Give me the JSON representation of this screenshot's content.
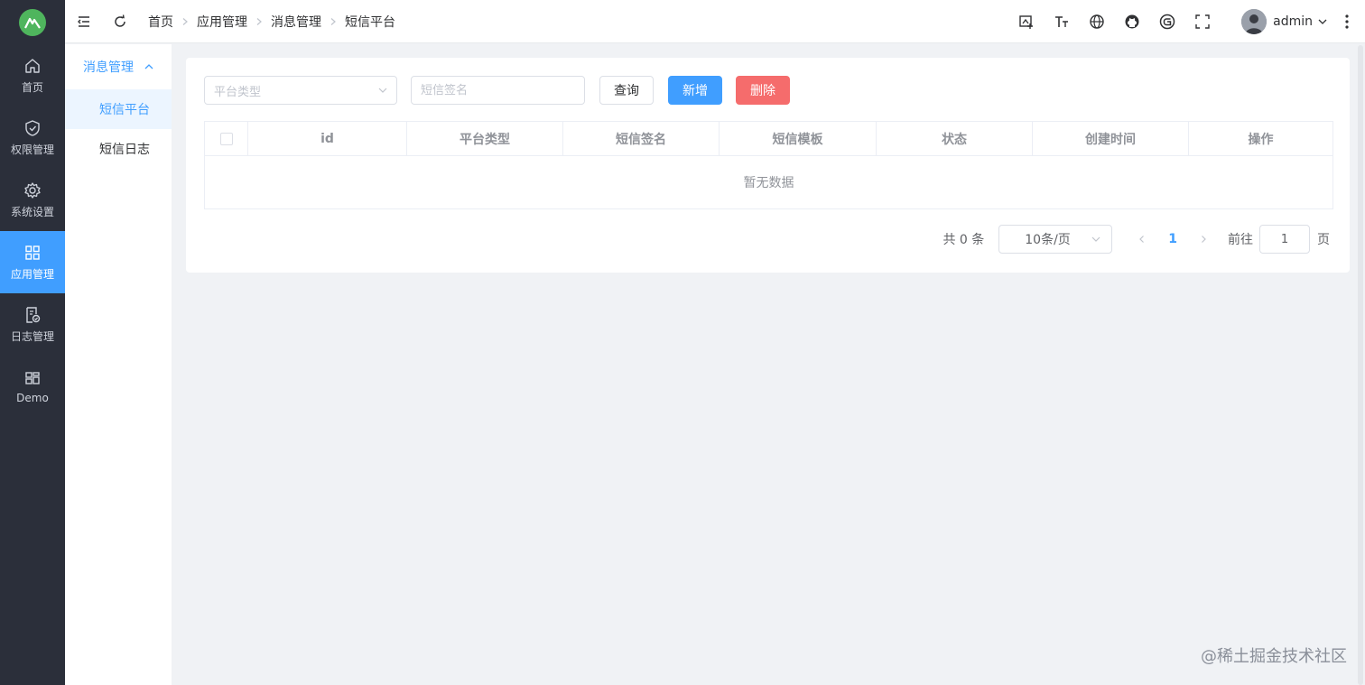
{
  "rail": {
    "items": [
      {
        "label": "首页",
        "icon": "home-icon"
      },
      {
        "label": "权限管理",
        "icon": "shield-icon"
      },
      {
        "label": "系统设置",
        "icon": "gear-icon"
      },
      {
        "label": "应用管理",
        "icon": "grid-icon",
        "active": true
      },
      {
        "label": "日志管理",
        "icon": "log-icon"
      },
      {
        "label": "Demo",
        "icon": "layout-icon"
      }
    ]
  },
  "submenu": {
    "group": "消息管理",
    "items": [
      {
        "label": "短信平台",
        "active": true
      },
      {
        "label": "短信日志"
      }
    ]
  },
  "breadcrumb": [
    "首页",
    "应用管理",
    "消息管理",
    "短信平台"
  ],
  "user": {
    "name": "admin"
  },
  "toolbar": {
    "platform_placeholder": "平台类型",
    "sign_placeholder": "短信签名",
    "query_label": "查询",
    "add_label": "新增",
    "delete_label": "删除"
  },
  "table": {
    "columns": [
      "id",
      "平台类型",
      "短信签名",
      "短信模板",
      "状态",
      "创建时间",
      "操作"
    ],
    "empty_text": "暂无数据"
  },
  "pagination": {
    "total_text": "共 0 条",
    "page_size": "10条/页",
    "current_page": "1",
    "goto_label": "前往",
    "goto_value": "1",
    "page_suffix": "页"
  },
  "colors": {
    "accent": "#409eff",
    "danger": "#f56c6c",
    "rail_bg": "#2b2f3a",
    "logo": "#4fb55d"
  },
  "watermark": "@稀土掘金技术社区"
}
